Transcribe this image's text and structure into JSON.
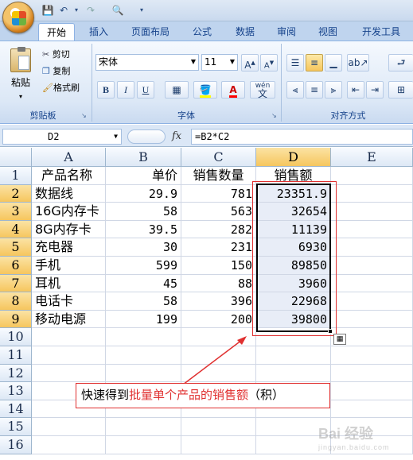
{
  "ribbon": {
    "tabs": [
      "开始",
      "插入",
      "页面布局",
      "公式",
      "数据",
      "审阅",
      "视图",
      "开发工具"
    ],
    "clipboard": {
      "paste": "粘贴",
      "cut": "剪切",
      "copy": "复制",
      "format_painter": "格式刷",
      "label": "剪贴板"
    },
    "font": {
      "name": "宋体",
      "size": "11",
      "label": "字体",
      "bold": "B",
      "italic": "I",
      "underline": "U",
      "phonetic": "wén"
    },
    "alignment": {
      "label": "对齐方式"
    },
    "colors": {
      "accent": "#15428b",
      "selected_header": "#f6c65e",
      "annotation": "#e03030"
    }
  },
  "formula_bar": {
    "name_box": "D2",
    "fx": "fx",
    "formula": "=B2*C2"
  },
  "sheet": {
    "columns": [
      "A",
      "B",
      "C",
      "D",
      "E"
    ],
    "row_numbers": [
      "1",
      "2",
      "3",
      "4",
      "5",
      "6",
      "7",
      "8",
      "9",
      "10",
      "11",
      "12",
      "13",
      "14",
      "15",
      "16"
    ],
    "headers": [
      "产品名称",
      "单价",
      "销售数量",
      "销售额"
    ],
    "rows": [
      {
        "name": "数据线",
        "price": "29.9",
        "qty": "781",
        "sales": "23351.9"
      },
      {
        "name": "16G内存卡",
        "price": "58",
        "qty": "563",
        "sales": "32654"
      },
      {
        "name": "8G内存卡",
        "price": "39.5",
        "qty": "282",
        "sales": "11139"
      },
      {
        "name": "充电器",
        "price": "30",
        "qty": "231",
        "sales": "6930"
      },
      {
        "name": "手机",
        "price": "599",
        "qty": "150",
        "sales": "89850"
      },
      {
        "name": "耳机",
        "price": "45",
        "qty": "88",
        "sales": "3960"
      },
      {
        "name": "电话卡",
        "price": "58",
        "qty": "396",
        "sales": "22968"
      },
      {
        "name": "移动电源",
        "price": "199",
        "qty": "200",
        "sales": "39800"
      }
    ],
    "selected_range": "D2:D9"
  },
  "annotation": {
    "prefix": "快速得到",
    "highlight": "批量单个产品的销售额",
    "suffix": "（积）"
  },
  "watermark": {
    "main": "Bai 经验",
    "sub": "jingyan.baidu.com"
  }
}
